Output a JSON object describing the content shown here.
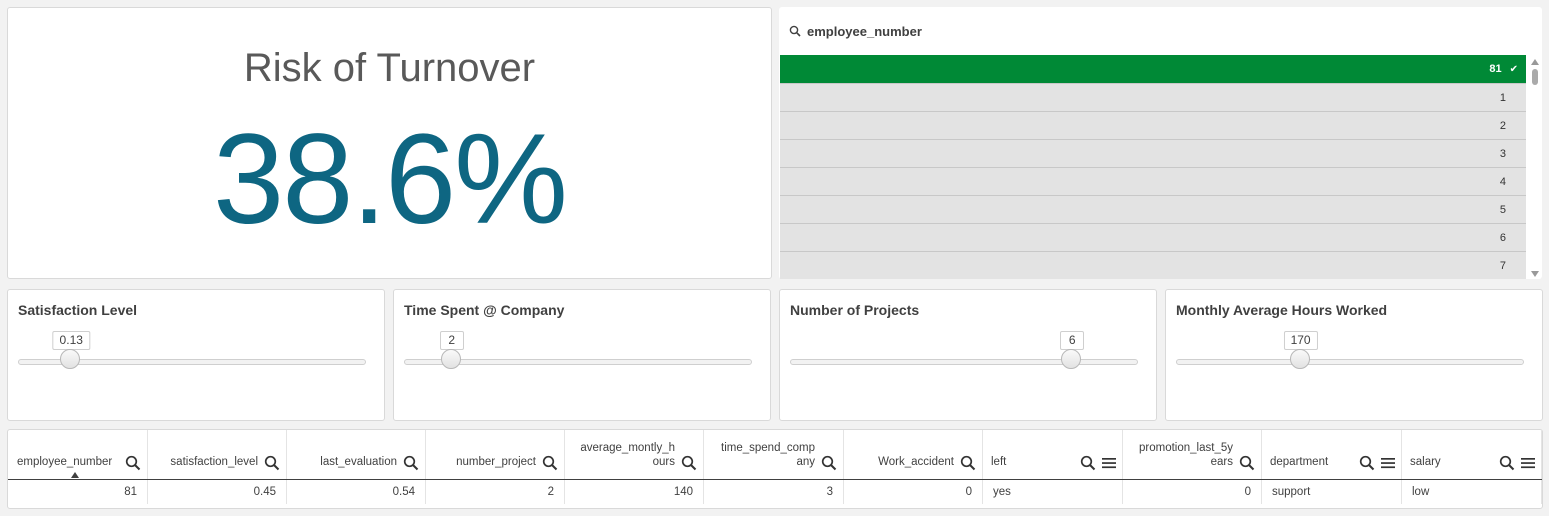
{
  "kpi": {
    "title": "Risk of Turnover",
    "value": "38.6%"
  },
  "filter": {
    "field_name": "employee_number",
    "items": [
      {
        "label": "81",
        "selected": true
      },
      {
        "label": "1",
        "selected": false
      },
      {
        "label": "2",
        "selected": false
      },
      {
        "label": "3",
        "selected": false
      },
      {
        "label": "4",
        "selected": false
      },
      {
        "label": "5",
        "selected": false
      },
      {
        "label": "6",
        "selected": false
      },
      {
        "label": "7",
        "selected": false
      }
    ],
    "selected_color": "#008936"
  },
  "sliders": [
    {
      "title": "Satisfaction Level",
      "value_label": "0.13",
      "position_fraction": 0.153
    },
    {
      "title": "Time Spent @ Company",
      "value_label": "2",
      "position_fraction": 0.137
    },
    {
      "title": "Number of Projects",
      "value_label": "6",
      "position_fraction": 0.811
    },
    {
      "title": "Monthly Average Hours Worked",
      "value_label": "170",
      "position_fraction": 0.358
    }
  ],
  "table": {
    "columns": [
      {
        "label": "employee_number",
        "search": true,
        "menu": false,
        "sorted": true
      },
      {
        "label": "satisfaction_level",
        "search": true,
        "menu": false
      },
      {
        "label": "last_evaluation",
        "search": true,
        "menu": false
      },
      {
        "label": "number_project",
        "search": true,
        "menu": false
      },
      {
        "label": "average_montly_h ours",
        "search": true,
        "menu": false
      },
      {
        "label": "time_spend_comp any",
        "search": true,
        "menu": false
      },
      {
        "label": "Work_accident",
        "search": true,
        "menu": false
      },
      {
        "label": "left",
        "search": true,
        "menu": true
      },
      {
        "label": "promotion_last_5y ears",
        "search": true,
        "menu": false
      },
      {
        "label": "department",
        "search": true,
        "menu": true
      },
      {
        "label": "salary",
        "search": true,
        "menu": true
      }
    ],
    "rows": [
      [
        "81",
        "0.45",
        "0.54",
        "2",
        "140",
        "3",
        "0",
        "yes",
        "0",
        "support",
        "low"
      ]
    ]
  },
  "colors": {
    "kpi_value": "#0e6682",
    "selected_row": "#008936"
  }
}
